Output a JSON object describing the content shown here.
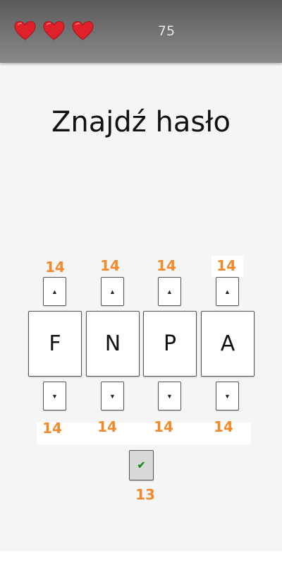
{
  "header": {
    "lives": 3,
    "score": "75"
  },
  "title": "Znajdź hasło",
  "columns": [
    {
      "letter": "F",
      "up_count": "14",
      "down_count": "14",
      "up_icon": "▲",
      "down_icon": "▼"
    },
    {
      "letter": "N",
      "up_count": "14",
      "down_count": "14",
      "up_icon": "▲",
      "down_icon": "▼"
    },
    {
      "letter": "P",
      "up_count": "14",
      "down_count": "14",
      "up_icon": "▲",
      "down_icon": "▼"
    },
    {
      "letter": "A",
      "up_count": "14",
      "down_count": "14",
      "up_icon": "▲",
      "down_icon": "▼"
    }
  ],
  "submit": {
    "icon": "✔",
    "count": "13"
  },
  "colors": {
    "accent_count": "#f28a2c",
    "heart": "#e0202a",
    "check": "#1a8a1a"
  }
}
